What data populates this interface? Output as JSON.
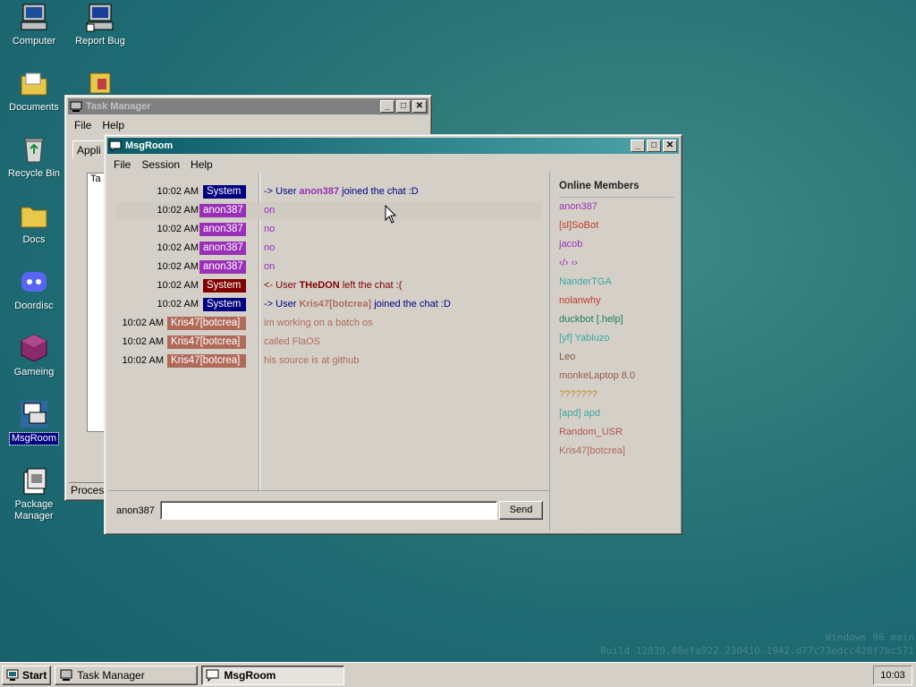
{
  "desktop": {
    "icons": [
      {
        "label": "Computer"
      },
      {
        "label": "Report Bug"
      },
      {
        "label": "Documents"
      },
      {
        "label": "Recycle Bin"
      },
      {
        "label": "Docs"
      },
      {
        "label": "Doordisc"
      },
      {
        "label": "Gameing"
      },
      {
        "label": "MsgRoom"
      },
      {
        "label": "Package Manager"
      }
    ],
    "watermark": {
      "line1": "Windows 96 main",
      "line2": "Build 12839.88efa922.230410-1942.d77c73edcc428f7bc571"
    }
  },
  "task_manager": {
    "title": "Task Manager",
    "menu": [
      "File",
      "Help"
    ],
    "tab_label": "Appli",
    "list_header": "Ta",
    "status_label": "Process"
  },
  "msgroom": {
    "title": "MsgRoom",
    "menu": [
      "File",
      "Session",
      "Help"
    ],
    "messages": [
      {
        "time": "10:02 AM",
        "nick": "System",
        "parts": [
          "-> User ",
          "anon387",
          " joined the chat :D"
        ]
      },
      {
        "time": "10:02 AM",
        "nick": "anon387",
        "text": "on"
      },
      {
        "time": "10:02 AM",
        "nick": "anon387",
        "text": "no"
      },
      {
        "time": "10:02 AM",
        "nick": "anon387",
        "text": "no"
      },
      {
        "time": "10:02 AM",
        "nick": "anon387",
        "text": "on"
      },
      {
        "time": "10:02 AM",
        "nick": "System",
        "parts": [
          "<- User ",
          "THeDON",
          " left the chat :("
        ]
      },
      {
        "time": "10:02 AM",
        "nick": "System",
        "parts": [
          "-> User ",
          "Kris47[botcrea]",
          " joined the chat :D"
        ]
      },
      {
        "time": "10:02 AM",
        "nick": "Kris47[botcrea]",
        "text": "im working on a batch os"
      },
      {
        "time": "10:02 AM",
        "nick": "Kris47[botcrea]",
        "text": "called FlaOS"
      },
      {
        "time": "10:02 AM",
        "nick": "Kris47[botcrea]",
        "text": "his source is at github"
      }
    ],
    "members_header": "Online Members",
    "members": [
      {
        "name": "anon387",
        "color": "#9a2fb8"
      },
      {
        "name": "[sl]SoBot",
        "color": "#c0392b"
      },
      {
        "name": "jacob",
        "color": "#9a2fb8"
      },
      {
        "name": "‹/› ‹›",
        "color": "#9a2fb8"
      },
      {
        "name": "NanderTGA",
        "color": "#3aa6a0"
      },
      {
        "name": "nolanwhy",
        "color": "#c0392b"
      },
      {
        "name": "duckbot [.help]",
        "color": "#1f7a5a"
      },
      {
        "name": "[yf] Yabluzo",
        "color": "#3aa6a0"
      },
      {
        "name": "Leo",
        "color": "#7a5a3a"
      },
      {
        "name": "monkeLaptop 8.0",
        "color": "#9a5a4a"
      },
      {
        "name": "???????",
        "color": "#c08a2a"
      },
      {
        "name": "[apd] apd",
        "color": "#3aa6a0"
      },
      {
        "name": "Random_USR",
        "color": "#b0504a"
      },
      {
        "name": "Kris47[botcrea]",
        "color": "#b06a5a"
      }
    ],
    "current_user": "anon387",
    "input_value": "",
    "send_label": "Send"
  },
  "colors": {
    "system_join": "#000080",
    "system_leave": "#800000",
    "anon387": "#9a2fb8",
    "kris": "#b06a5a"
  },
  "taskbar": {
    "start_label": "Start",
    "buttons": [
      {
        "label": "Task Manager",
        "active": false
      },
      {
        "label": "MsgRoom",
        "active": true
      }
    ],
    "clock": "10:03"
  }
}
